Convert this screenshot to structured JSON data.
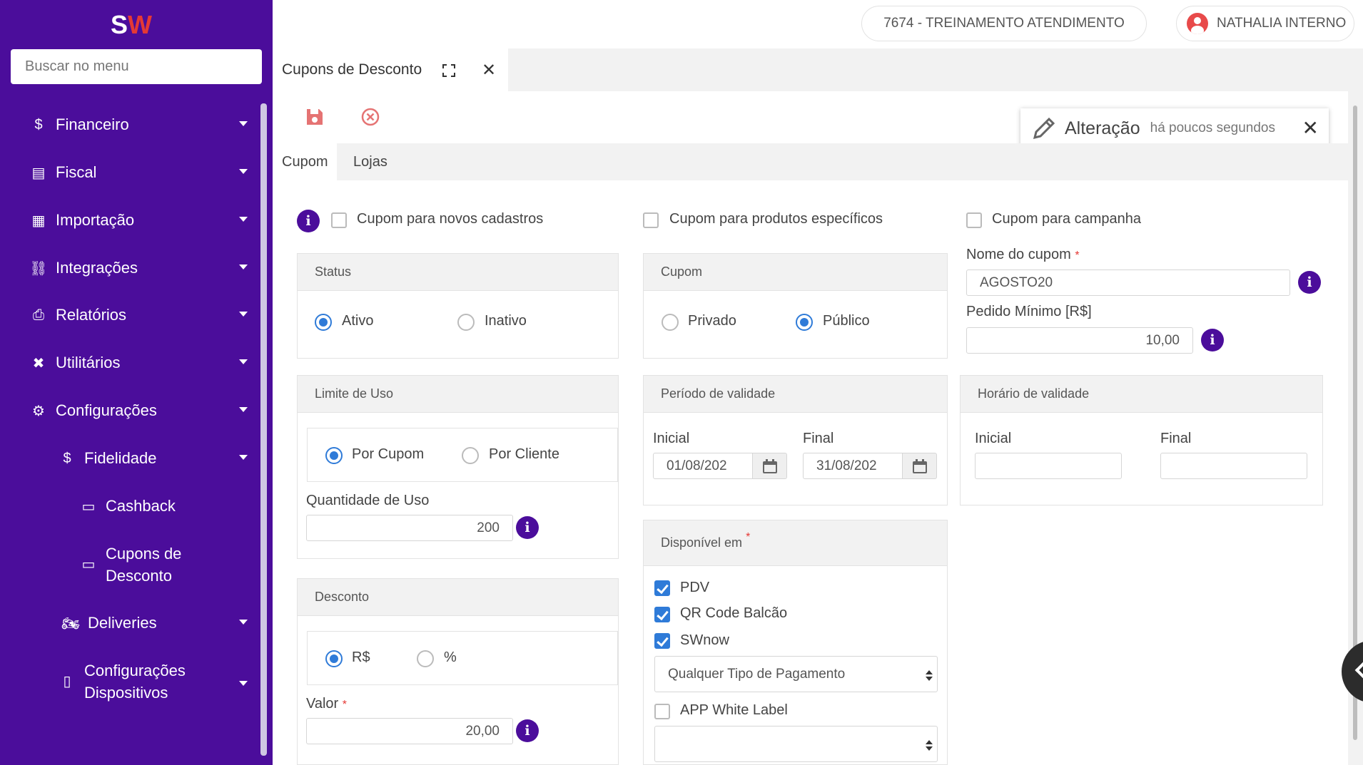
{
  "app": {
    "logo_text": "SW"
  },
  "sidebar": {
    "search_placeholder": "Buscar no menu",
    "items": [
      {
        "label": "Financeiro",
        "icon": "dollar-icon"
      },
      {
        "label": "Fiscal",
        "icon": "document-icon"
      },
      {
        "label": "Importação",
        "icon": "file-icon"
      },
      {
        "label": "Integrações",
        "icon": "network-icon"
      },
      {
        "label": "Relatórios",
        "icon": "printer-icon"
      },
      {
        "label": "Utilitários",
        "icon": "tools-icon"
      },
      {
        "label": "Configurações",
        "icon": "gears-icon"
      },
      {
        "label": "Fidelidade",
        "icon": "dollar-icon"
      },
      {
        "label": "Cashback",
        "icon": "card-icon"
      },
      {
        "label_line1": "Cupons de",
        "label_line2": "Desconto",
        "icon": "card-icon"
      },
      {
        "label": "Deliveries",
        "icon": "motorcycle-icon"
      },
      {
        "label_line1": "Configurações",
        "label_line2": "Dispositivos",
        "icon": "mobile-icon"
      }
    ]
  },
  "topbar": {
    "store": "7674 - TREINAMENTO ATENDIMENTO",
    "user": "NATHALIA INTERNO"
  },
  "page": {
    "tab_title": "Cupons de Desconto",
    "tabs": [
      "Cupom",
      "Lojas"
    ],
    "toast": {
      "title": "Alteração",
      "subtitle": "há poucos segundos"
    }
  },
  "form": {
    "checks_top": {
      "novos_cadastros": "Cupom para novos cadastros",
      "produtos": "Cupom para produtos específicos",
      "campanha": "Cupom para campanha"
    },
    "status": {
      "title": "Status",
      "ativo": "Ativo",
      "inativo": "Inativo",
      "selected": "Ativo"
    },
    "cupom": {
      "title": "Cupom",
      "privado": "Privado",
      "publico": "Público",
      "selected": "Público"
    },
    "nome": {
      "label": "Nome do cupom",
      "required": "*",
      "value": "AGOSTO20"
    },
    "pedido_minimo": {
      "label": "Pedido Mínimo [R$]",
      "value": "10,00"
    },
    "limite": {
      "title": "Limite de Uso",
      "por_cupom": "Por Cupom",
      "por_cliente": "Por Cliente",
      "selected": "Por Cupom",
      "qtd_label": "Quantidade de Uso",
      "qtd_value": "200"
    },
    "periodo": {
      "title": "Período de validade",
      "inicial_label": "Inicial",
      "inicial_value": "01/08/202",
      "final_label": "Final",
      "final_value": "31/08/202"
    },
    "horario": {
      "title": "Horário de validade",
      "inicial_label": "Inicial",
      "inicial_value": "",
      "final_label": "Final",
      "final_value": ""
    },
    "desconto": {
      "title": "Desconto",
      "reais": "R$",
      "percent": "%",
      "selected": "R$",
      "valor_label": "Valor",
      "required": "*",
      "valor_value": "20,00"
    },
    "disponivel": {
      "title": "Disponível em",
      "required": "*",
      "pdv": "PDV",
      "qrcode": "QR Code Balcão",
      "swnow": "SWnow",
      "pagamento": "Qualquer Tipo de Pagamento",
      "app_white_label": "APP White Label",
      "app_select_value": ""
    }
  },
  "colors": {
    "sidebar": "#4b0d9b",
    "accent": "#2f7bd8",
    "toolbar_icon": "#e57373",
    "logo_w": "#e53935"
  }
}
